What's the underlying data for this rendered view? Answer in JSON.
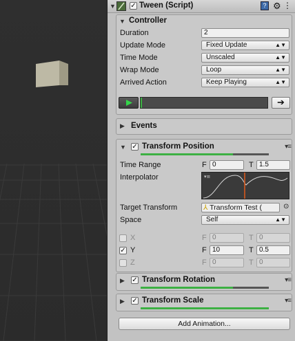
{
  "component": {
    "title": "Tween (Script)"
  },
  "controller": {
    "title": "Controller",
    "fields": [
      {
        "label": "Duration",
        "value": "2"
      },
      {
        "label": "Update Mode",
        "value": "Fixed Update"
      },
      {
        "label": "Time Mode",
        "value": "Unscaled"
      },
      {
        "label": "Wrap Mode",
        "value": "Loop"
      },
      {
        "label": "Arrived Action",
        "value": "Keep Playing"
      }
    ],
    "play_icon": "play-icon",
    "step_icon": "arrow-right-icon"
  },
  "events": {
    "title": "Events"
  },
  "transform_position": {
    "title": "Transform Position",
    "progress": 0.72,
    "time_range_label": "Time Range",
    "from_label": "F",
    "from_value": "0",
    "to_label": "T",
    "to_value": "1.5",
    "interpolator_label": "Interpolator",
    "target_label": "Target Transform",
    "target_value": "Transform Test (",
    "space_label": "Space",
    "space_value": "Self",
    "axes": [
      {
        "axis": "X",
        "checked": false,
        "from": "0",
        "to": "0"
      },
      {
        "axis": "Y",
        "checked": true,
        "from": "10",
        "to": "0.5"
      },
      {
        "axis": "Z",
        "checked": false,
        "from": "0",
        "to": "0"
      }
    ]
  },
  "transform_rotation": {
    "title": "Transform Rotation",
    "progress": 0.72
  },
  "transform_scale": {
    "title": "Transform Scale",
    "progress": 1.0
  },
  "add_animation_label": "Add Animation...",
  "colors": {
    "green": "#3cb043",
    "curve_marker": "#e05a1a"
  }
}
